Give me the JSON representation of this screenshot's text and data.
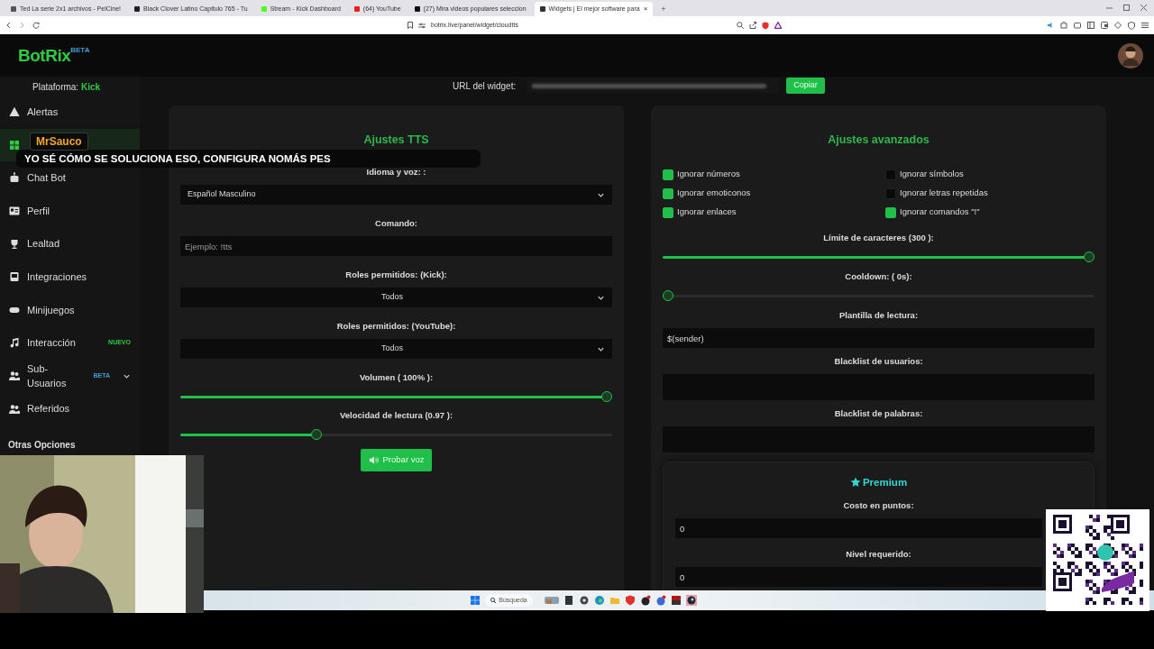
{
  "browser": {
    "tabs": [
      {
        "title": "Ted La serie 2x1 archivos - PelCine!",
        "selected": false
      },
      {
        "title": "Black Clover Latino Capitulo 765 - Tu",
        "selected": false
      },
      {
        "title": "Stream - Kick Dashboard",
        "selected": false
      },
      {
        "title": "(64) YouTube",
        "selected": false
      },
      {
        "title": "(27) Mira videos populares seleccion",
        "selected": false
      },
      {
        "title": "Widgets | El mejor software para",
        "selected": true
      }
    ],
    "close_tab": "×",
    "new_tab": "+",
    "url": "botrix.live/panel/widget/cloudtts"
  },
  "header": {
    "logo": "BotRix",
    "logo_badge": "BETA"
  },
  "sidebar": {
    "platform_label": "Plataforma:",
    "platform": "Kick",
    "items": [
      {
        "label": "Alertas",
        "selected": false,
        "kind": "link"
      },
      {
        "selected": true,
        "kind": "link"
      },
      {
        "label": "Chat Bot",
        "selected": false,
        "kind": "link"
      },
      {
        "label": "Perfil",
        "selected": false,
        "kind": "link"
      },
      {
        "label": "Lealtad",
        "selected": false,
        "kind": "link"
      },
      {
        "label": "Integraciones",
        "selected": false,
        "kind": "link"
      },
      {
        "label": "Minijuegos",
        "selected": false,
        "kind": "link"
      },
      {
        "label": "Interacción",
        "selected": false,
        "kind": "link",
        "badge": {
          "text": "NUEVO",
          "color": "#2ecc40"
        }
      },
      {
        "label": "Sub-Usuarios",
        "selected": false,
        "kind": "group",
        "badge": {
          "text": "BETA",
          "color": "#3b9fd8"
        }
      },
      {
        "label": "Referidos",
        "selected": false,
        "kind": "link"
      }
    ],
    "section": "Otras Opciones"
  },
  "widget_url": {
    "label": "URL del widget:",
    "button": "Copiar"
  },
  "tts": {
    "title": "Ajustes TTS",
    "fields": [
      {
        "kind": "select",
        "label": "Idioma y voz: :",
        "value": "Español Masculino",
        "centered": false
      },
      {
        "kind": "input",
        "label": "Comando:",
        "placeholder": "Ejemplo: !tts"
      },
      {
        "kind": "select",
        "label": "Roles permitidos: (Kick):",
        "value": "Todos",
        "centered": true
      },
      {
        "kind": "select",
        "label": "Roles permitidos: (YouTube):",
        "value": "Todos",
        "centered": true
      },
      {
        "kind": "slider",
        "label": "Volumen ( 100% ):",
        "level": 1
      },
      {
        "kind": "slider",
        "label": "Velocidad de lectura (0.97 ):",
        "level": 0.31
      }
    ],
    "button": "Probar voz"
  },
  "advanced": {
    "title": "Ajustes avanzados",
    "checks": [
      {
        "label": "Ignorar números",
        "checked": true
      },
      {
        "label": "Ignorar símbolos",
        "checked": false
      },
      {
        "label": "Ignorar emoticonos",
        "checked": true
      },
      {
        "label": "Ignorar letras repetidas",
        "checked": false
      },
      {
        "label": "Ignorar enlaces",
        "checked": true
      },
      {
        "label": "Ignorar comandos \"!\"",
        "checked": true
      }
    ],
    "fields": [
      {
        "kind": "slider",
        "label": "Límite de caracteres (300 ):",
        "level": 1
      },
      {
        "kind": "slider",
        "label": "Cooldown: ( 0s):",
        "level": 0
      },
      {
        "kind": "input",
        "label": "Plantilla de lectura:",
        "value": "$(sender)"
      },
      {
        "kind": "textarea",
        "label": "Blacklist de usuarios:"
      },
      {
        "kind": "textarea",
        "label": "Blacklist de palabras:"
      }
    ],
    "premium": {
      "title": "Premium",
      "fields": [
        {
          "kind": "input",
          "label": "Costo en puntos:",
          "value": "0"
        },
        {
          "kind": "input",
          "label": "Nivel requerido:",
          "value": "0"
        }
      ]
    }
  },
  "chat_overlay": {
    "user": "MrSauco",
    "message": "YO SÉ CÓMO SE SOLUCIONA ESO, CONFIGURA NOMÁS PES"
  },
  "taskbar": {
    "search": "Búsqueda"
  }
}
